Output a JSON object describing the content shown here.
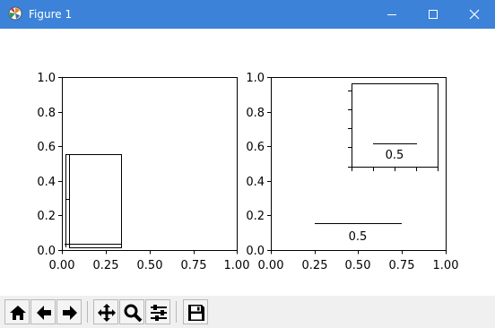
{
  "window": {
    "title": "Figure 1",
    "titlebar_color": "#3c82d8",
    "app_icon": "matplotlib-icon",
    "controls": [
      "minimize-icon",
      "maximize-icon",
      "close-icon"
    ]
  },
  "figure": {
    "left_axes": {
      "xlim": [
        0.0,
        1.0
      ],
      "ylim": [
        0.0,
        1.0
      ],
      "xticks": [
        "0.00",
        "0.25",
        "0.50",
        "0.75",
        "1.00"
      ],
      "yticks": [
        "0.0",
        "0.2",
        "0.4",
        "0.6",
        "0.8",
        "1.0"
      ]
    },
    "right_axes": {
      "xlim": [
        0.0,
        1.0
      ],
      "ylim": [
        0.0,
        1.0
      ],
      "xticks": [
        "0.00",
        "0.25",
        "0.50",
        "0.75",
        "1.00"
      ],
      "yticks": [
        "0.0",
        "0.2",
        "0.4",
        "0.6",
        "0.8",
        "1.0"
      ],
      "scalebar_label": "0.5",
      "inset_scalebar_label": "0.5"
    }
  },
  "toolbar": {
    "buttons": [
      {
        "name": "home-icon"
      },
      {
        "name": "back-icon"
      },
      {
        "name": "forward-icon"
      },
      {
        "name": "pan-icon"
      },
      {
        "name": "zoom-icon"
      },
      {
        "name": "configure-subplots-icon"
      },
      {
        "name": "save-icon"
      }
    ]
  }
}
